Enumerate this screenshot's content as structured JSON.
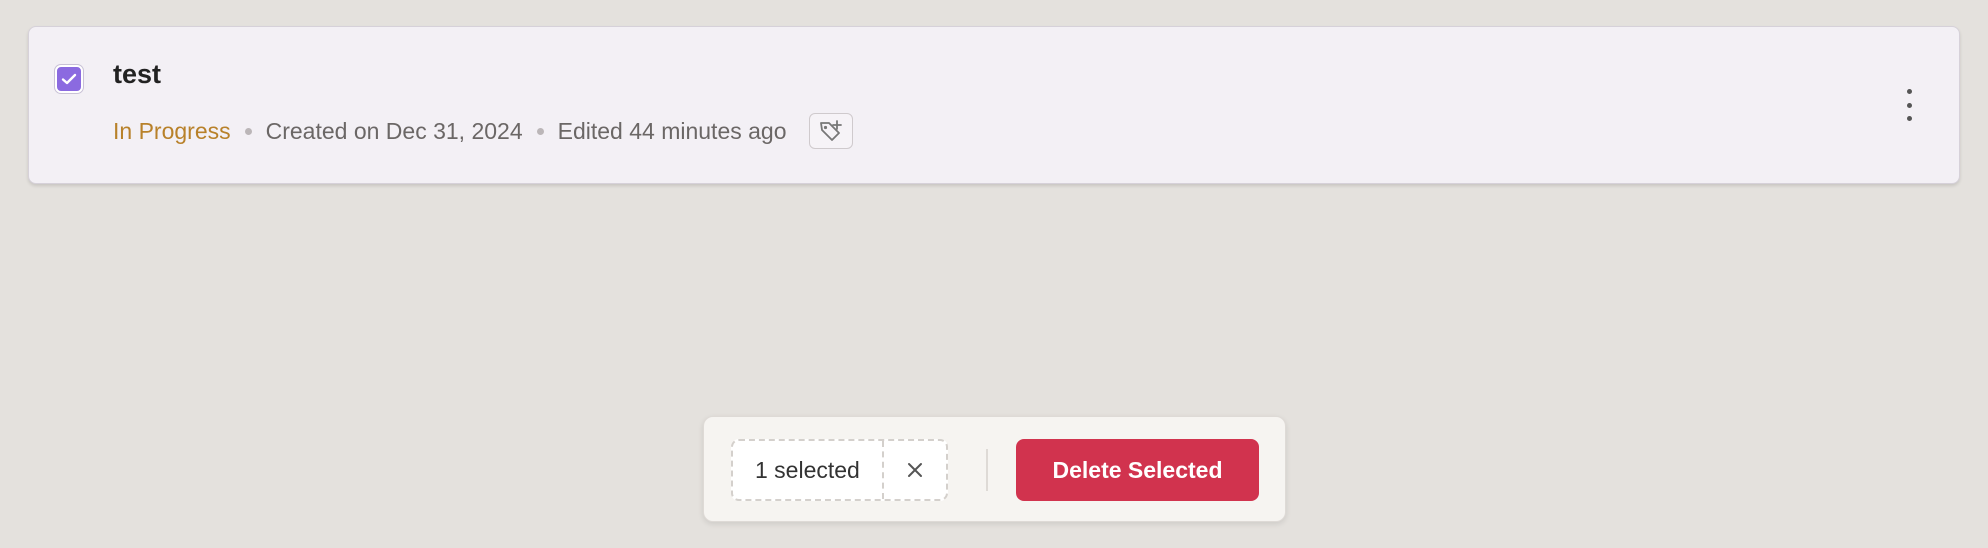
{
  "item": {
    "title": "test",
    "checked": true,
    "status": "In Progress",
    "created": "Created on Dec 31, 2024",
    "edited": "Edited 44 minutes ago",
    "tag_icon": "add-tag-icon",
    "menu_icon": "more-vertical-icon"
  },
  "bulk_bar": {
    "selected_label": "1 selected",
    "clear_icon": "close-icon",
    "delete_label": "Delete Selected"
  },
  "colors": {
    "accent": "#8b6ae0",
    "status_in_progress": "#b8812a",
    "danger": "#d1334e"
  }
}
